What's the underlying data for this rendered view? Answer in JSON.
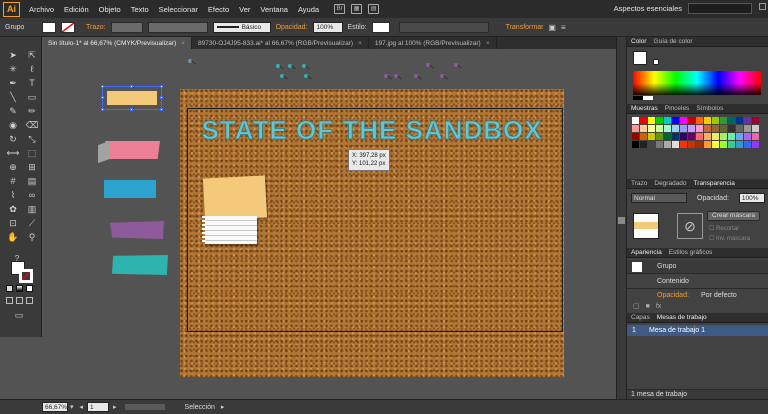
{
  "app": {
    "logo": "Ai"
  },
  "menubar": {
    "items": [
      "Archivo",
      "Edición",
      "Objeto",
      "Texto",
      "Seleccionar",
      "Efecto",
      "Ver",
      "Ventana",
      "Ayuda"
    ],
    "workspace": "Aspectos esenciales"
  },
  "control": {
    "selection": "Grupo",
    "stroke_label": "Trazo:",
    "stroke_style": "Básico",
    "opacity_label": "Opacidad:",
    "opacity_value": "100%",
    "style_label": "Estilo:",
    "transform_label": "Transformar"
  },
  "tabs": [
    {
      "label": "Sin título-1* al 66,67% (CMYK/Previsualizar)"
    },
    {
      "label": "89730-OJ4J95-833.ai* al 66,67% (RGB/Previsualizar)"
    },
    {
      "label": "197.jpg al 100% (RGB/Previsualizar)"
    }
  ],
  "canvas": {
    "headline": "STATE OF THE SANDBOX",
    "coord_x": "X: 397,28 px",
    "coord_y": "Y: 101,22 px"
  },
  "colors": {
    "tape_pink": "#ec7f93",
    "tape_blue": "#2ba3cf",
    "tape_purple": "#8f5a9c",
    "tape_teal": "#2fb3ae",
    "sticky": "#f5c97a",
    "cork": "#b27634",
    "selection": "#3f6cff",
    "accent": "#f29c38"
  },
  "panels": {
    "color_tabs": [
      "Color",
      "Guía de color"
    ],
    "swatch_tabs": [
      "Muestras",
      "Pinceles",
      "Símbolos"
    ],
    "trans_tabs": [
      "Trazo",
      "Degradado",
      "Transparencia"
    ],
    "blend_mode": "Normal",
    "opacity_label": "Opacidad:",
    "opacity_value": "100%",
    "make_mask": "Crear máscara",
    "clip": "Recortar",
    "invert": "Inv. máscara",
    "appear_tabs": [
      "Apariencia",
      "Estilos gráficos"
    ],
    "appear_group": "Grupo",
    "appear_contents": "Contenido",
    "appear_opacity": "Opacidad:",
    "appear_default": "Por defecto",
    "layer_tabs": [
      "Capas",
      "Mesas de trabajo"
    ],
    "artboard_num": "1",
    "artboard_name": "Mesa de trabajo 1",
    "artboard_count": "1 mesa de trabajo"
  },
  "status": {
    "zoom": "66,67%",
    "page": "1",
    "tool": "Selección"
  }
}
